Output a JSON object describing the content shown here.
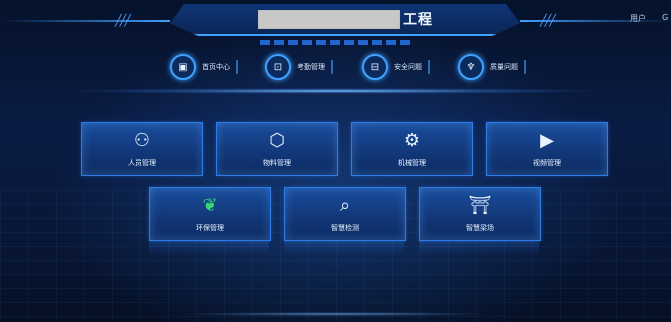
{
  "header": {
    "title": "工程",
    "user_label": "用户",
    "user_extra": "G"
  },
  "top_nav": [
    {
      "label": "首页中心",
      "icon": "monitor-chart-icon",
      "glyph": "▣"
    },
    {
      "label": "考勤管理",
      "icon": "clipboard-icon",
      "glyph": "⊡"
    },
    {
      "label": "安全问题",
      "icon": "alert-screen-icon",
      "glyph": "⊟"
    },
    {
      "label": "质量问题",
      "icon": "shield-icon",
      "glyph": "♆"
    }
  ],
  "modules": [
    {
      "label": "人员管理",
      "icon": "person-gear-icon",
      "glyph": "⚇"
    },
    {
      "label": "物料管理",
      "icon": "cube-icon",
      "glyph": "⬡"
    },
    {
      "label": "机械管理",
      "icon": "gears-icon",
      "glyph": "⚙"
    },
    {
      "label": "视频管理",
      "icon": "video-file-icon",
      "glyph": "▶"
    },
    {
      "label": "环保管理",
      "icon": "leaf-icon",
      "glyph": "❦"
    },
    {
      "label": "智慧检测",
      "icon": "search-arrow-icon",
      "glyph": "⌕"
    },
    {
      "label": "智慧梁场",
      "icon": "road-gate-icon",
      "glyph": "⛩"
    }
  ],
  "colors": {
    "accent": "#3ea0ff",
    "card": "#153f85",
    "leaf": "#39d37a"
  }
}
